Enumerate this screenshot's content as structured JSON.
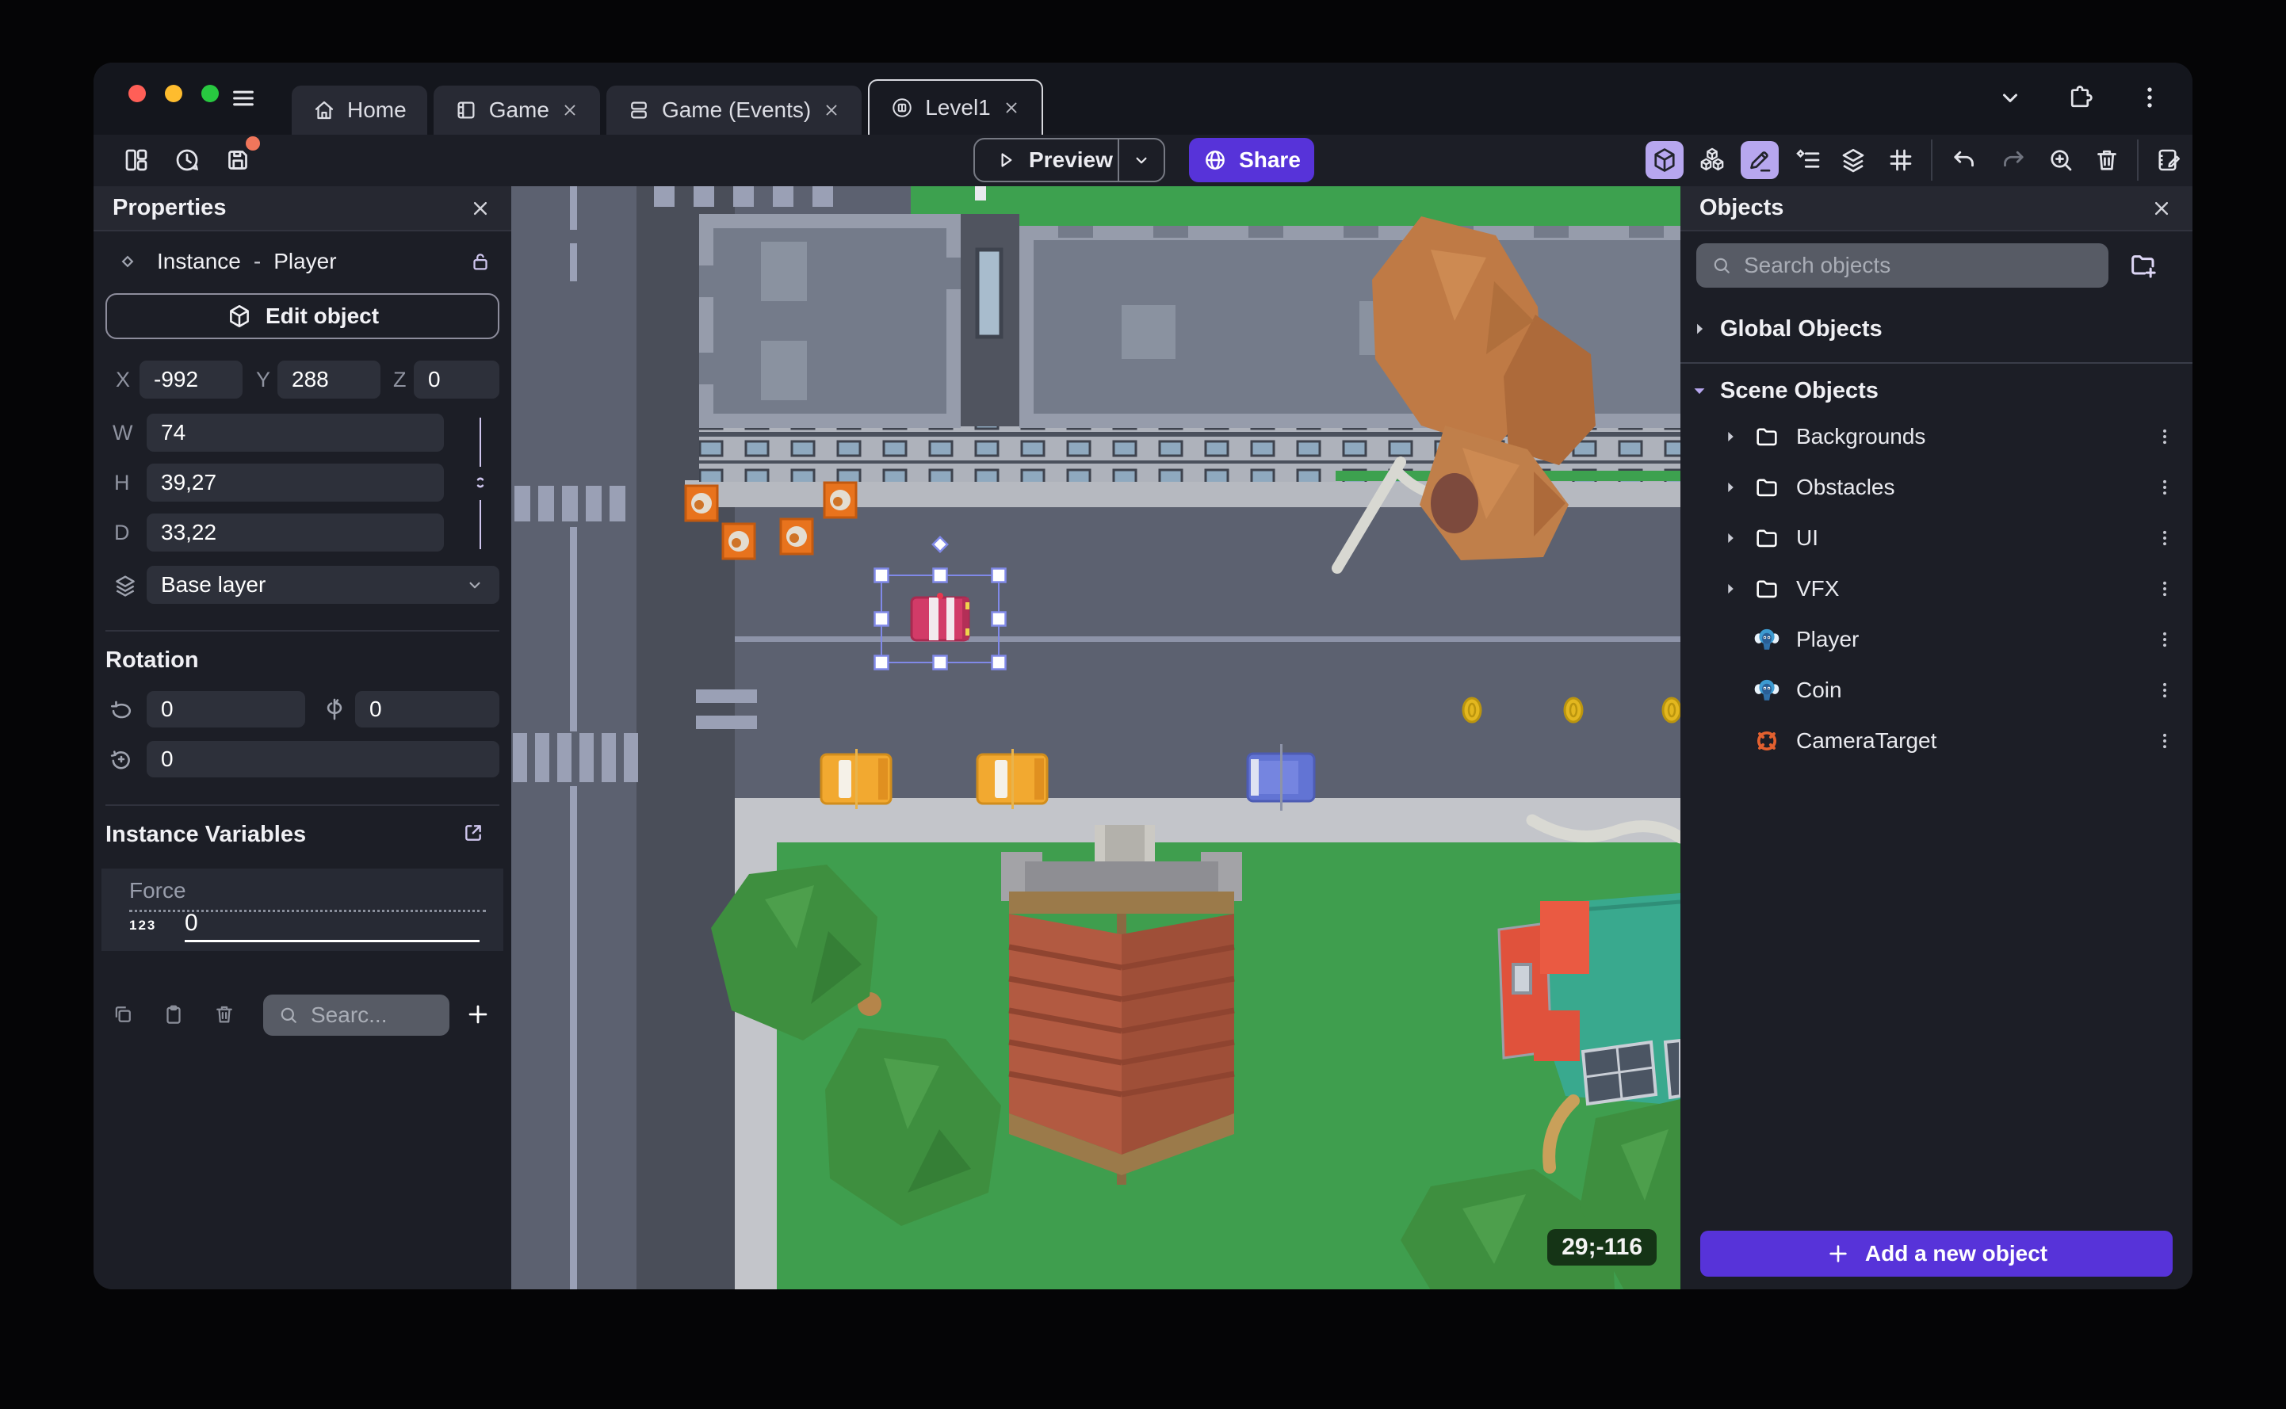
{
  "titlebar": {
    "tabs": [
      {
        "label": "Home"
      },
      {
        "label": "Game"
      },
      {
        "label": "Game (Events)"
      },
      {
        "label": "Level1"
      }
    ]
  },
  "toolbar": {
    "preview": "Preview",
    "share": "Share"
  },
  "properties": {
    "title": "Properties",
    "instance_label": "Instance",
    "separator": "-",
    "instance_name": "Player",
    "edit_object": "Edit object",
    "x_label": "X",
    "x_value": "-992",
    "y_label": "Y",
    "y_value": "288",
    "z_label": "Z",
    "z_value": "0",
    "w_label": "W",
    "w_value": "74",
    "h_label": "H",
    "h_value": "39,27",
    "d_label": "D",
    "d_value": "33,22",
    "layer_value": "Base layer",
    "rotation_title": "Rotation",
    "rotation_x": "0",
    "rotation_y": "0",
    "rotation_z": "0",
    "variables_title": "Instance Variables",
    "variable_name": "Force",
    "variable_type_badge": "123",
    "variable_value": "0",
    "variables_search_placeholder": "Searc..."
  },
  "objects": {
    "title": "Objects",
    "search_placeholder": "Search objects",
    "global_group": "Global Objects",
    "scene_group": "Scene Objects",
    "items": [
      {
        "label": "Backgrounds"
      },
      {
        "label": "Obstacles"
      },
      {
        "label": "UI"
      },
      {
        "label": "VFX"
      },
      {
        "label": "Player"
      },
      {
        "label": "Coin"
      },
      {
        "label": "CameraTarget"
      }
    ],
    "add_button": "Add a new object"
  },
  "canvas": {
    "cursor_coordinates": "29;-116"
  },
  "colors": {
    "accent_purple": "#5733d9",
    "toolbar_active_bg": "#b7a7ef",
    "unsaved_badge": "#f0765b",
    "grass": "#3f9e4e",
    "road": "#5c6170",
    "selection": "#8089e8"
  }
}
